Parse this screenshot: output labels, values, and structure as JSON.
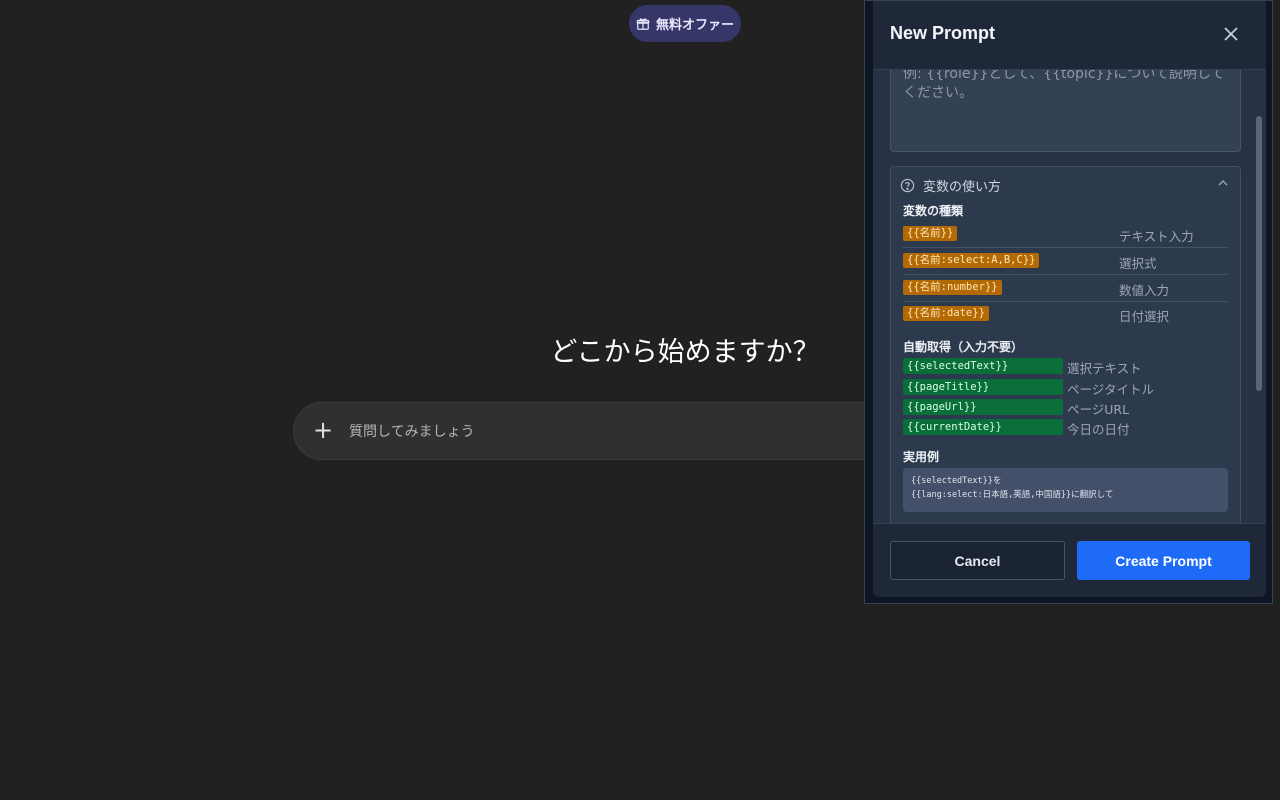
{
  "app": {
    "offer_label": "無料オファー",
    "hero_title": "どこから始めますか？",
    "composer_placeholder": "質問してみましょう",
    "composer_plus_icon": "plus-icon"
  },
  "dialog": {
    "title": "New Prompt",
    "close_icon": "close-icon",
    "textarea_placeholder": "例: {{role}}として、{{topic}}について説明してください。",
    "help": {
      "toggle_label": "変数の使い方",
      "types_title": "変数の種類",
      "types": [
        {
          "tag": "{{名前}}",
          "desc": "テキスト入力"
        },
        {
          "tag": "{{名前:select:A,B,C}}",
          "desc": "選択式"
        },
        {
          "tag": "{{名前:number}}",
          "desc": "数値入力"
        },
        {
          "tag": "{{名前:date}}",
          "desc": "日付選択"
        }
      ],
      "auto_title": "自動取得（入力不要）",
      "auto": [
        {
          "tag": "{{selectedText}}",
          "desc": "選択テキスト"
        },
        {
          "tag": "{{pageTitle}}",
          "desc": "ページタイトル"
        },
        {
          "tag": "{{pageUrl}}",
          "desc": "ページURL"
        },
        {
          "tag": "{{currentDate}}",
          "desc": "今日の日付"
        }
      ],
      "example_title": "実用例",
      "example_line1": "{{selectedText}}を",
      "example_line2": "{{lang:select:日本語,英語,中国語}}に翻訳して"
    },
    "cancel_label": "Cancel",
    "create_label": "Create Prompt"
  },
  "colors": {
    "background": "#212121",
    "dialog_bg": "#273244",
    "primary_button": "#1d6bf7",
    "tag_orange": "#b36a05",
    "tag_green": "#0a6e3a",
    "offer_pill": "#373669"
  }
}
